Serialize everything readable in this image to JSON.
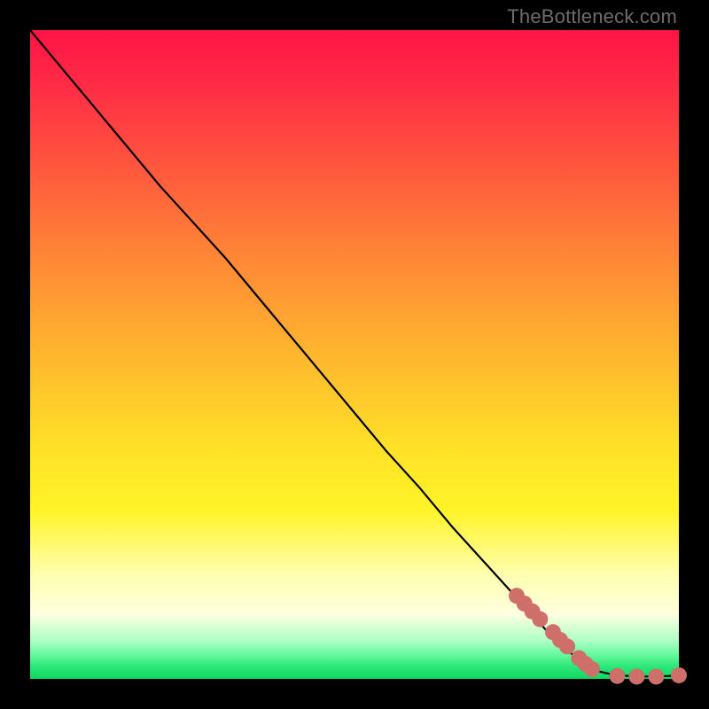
{
  "attribution": "TheBottleneck.com",
  "chart_data": {
    "type": "line",
    "title": "",
    "xlabel": "",
    "ylabel": "",
    "xlim": [
      0,
      100
    ],
    "ylim": [
      0,
      100
    ],
    "grid": false,
    "legend": false,
    "series": [
      {
        "name": "curve",
        "stroke": "#000000",
        "x": [
          0,
          5,
          10,
          15,
          20,
          25,
          30,
          35,
          40,
          45,
          50,
          55,
          60,
          65,
          70,
          75,
          80,
          85,
          87,
          90,
          93,
          96,
          100
        ],
        "y": [
          100,
          94,
          88,
          82,
          76,
          70.5,
          65,
          59,
          53,
          47,
          41,
          35,
          29.5,
          23.5,
          18,
          12.5,
          7,
          2.5,
          1.3,
          0.6,
          0.4,
          0.35,
          0.5
        ]
      }
    ],
    "markers": {
      "name": "highlight-dots",
      "color": "#cf6f6a",
      "radius_px": 9,
      "points": [
        {
          "x": 75.0,
          "y": 12.8
        },
        {
          "x": 76.2,
          "y": 11.6
        },
        {
          "x": 77.4,
          "y": 10.4
        },
        {
          "x": 78.6,
          "y": 9.2
        },
        {
          "x": 80.6,
          "y": 7.2
        },
        {
          "x": 81.7,
          "y": 6.0
        },
        {
          "x": 82.8,
          "y": 5.0
        },
        {
          "x": 84.6,
          "y": 3.2
        },
        {
          "x": 85.6,
          "y": 2.3
        },
        {
          "x": 86.6,
          "y": 1.5
        },
        {
          "x": 90.5,
          "y": 0.45
        },
        {
          "x": 93.5,
          "y": 0.35
        },
        {
          "x": 96.5,
          "y": 0.35
        },
        {
          "x": 100.0,
          "y": 0.55
        }
      ]
    }
  }
}
